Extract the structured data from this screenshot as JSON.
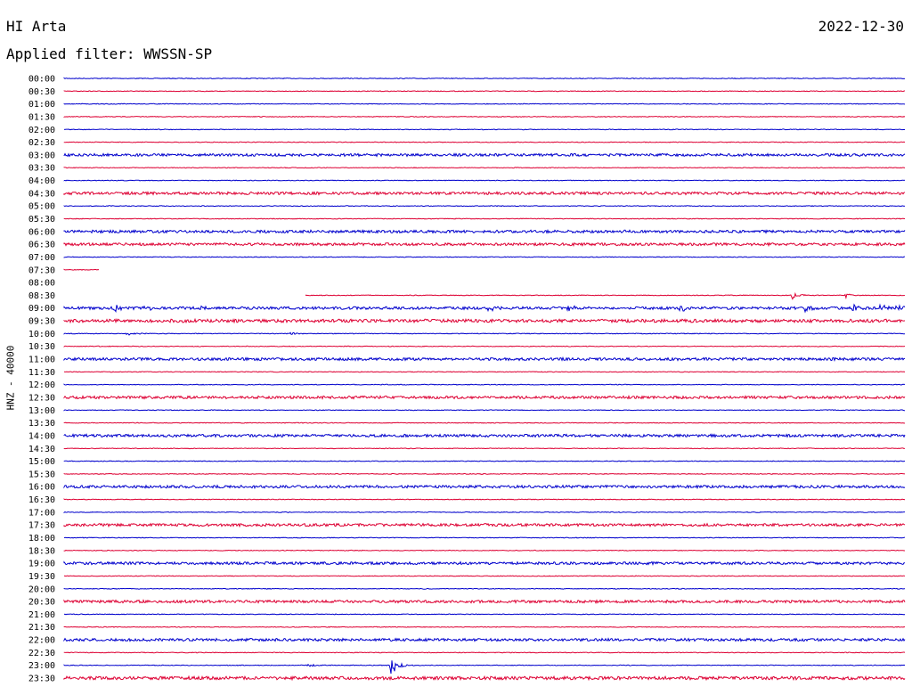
{
  "header": {
    "station": "HI Arta",
    "date": "2022-12-30",
    "filter": "Applied filter: WWSSN-SP"
  },
  "colors": {
    "even_row": "#0000cc",
    "odd_row": "#dd0033"
  },
  "chart_data": {
    "type": "line",
    "title": "HI Arta",
    "subtitle": "Applied filter: WWSSN-SP",
    "ylabel": "HNZ - 40000",
    "xlabel": "",
    "grid": false,
    "legend": "none",
    "rows": [
      {
        "label": "00:00"
      },
      {
        "label": "00:30"
      },
      {
        "label": "01:00",
        "events": [
          [
            0.045,
            1
          ]
        ]
      },
      {
        "label": "01:30"
      },
      {
        "label": "02:00"
      },
      {
        "label": "02:30"
      },
      {
        "label": "03:00",
        "noise": 1.5
      },
      {
        "label": "03:30"
      },
      {
        "label": "04:00"
      },
      {
        "label": "04:30",
        "noise": 1.5
      },
      {
        "label": "05:00"
      },
      {
        "label": "05:30"
      },
      {
        "label": "06:00",
        "noise": 1.5
      },
      {
        "label": "06:30",
        "noise": 1.5
      },
      {
        "label": "07:00"
      },
      {
        "label": "07:30",
        "start": 0.0,
        "end": 0.042
      },
      {
        "label": "08:00",
        "start": 1.0,
        "end": 1.0
      },
      {
        "label": "08:30",
        "start": 0.287,
        "events": [
          [
            0.865,
            6
          ],
          [
            0.93,
            3
          ]
        ]
      },
      {
        "label": "09:00",
        "noise": 1.5,
        "events": [
          [
            0.06,
            4
          ],
          [
            0.092,
            6
          ],
          [
            0.16,
            4
          ],
          [
            0.505,
            6
          ],
          [
            0.598,
            6
          ],
          [
            0.733,
            5
          ],
          [
            0.88,
            5
          ],
          [
            0.938,
            5
          ],
          [
            0.97,
            5
          ],
          [
            0.99,
            4
          ]
        ]
      },
      {
        "label": "09:30",
        "noise": 1.8
      },
      {
        "label": "10:00",
        "events": [
          [
            0.075,
            2
          ],
          [
            0.088,
            2
          ],
          [
            0.27,
            2
          ]
        ]
      },
      {
        "label": "10:30"
      },
      {
        "label": "11:00",
        "noise": 1.5
      },
      {
        "label": "11:30"
      },
      {
        "label": "12:00"
      },
      {
        "label": "12:30",
        "noise": 1.5
      },
      {
        "label": "13:00"
      },
      {
        "label": "13:30"
      },
      {
        "label": "14:00",
        "noise": 1.5
      },
      {
        "label": "14:30"
      },
      {
        "label": "15:00"
      },
      {
        "label": "15:30"
      },
      {
        "label": "16:00",
        "noise": 1.5
      },
      {
        "label": "16:30"
      },
      {
        "label": "17:00"
      },
      {
        "label": "17:30",
        "noise": 1.5
      },
      {
        "label": "18:00"
      },
      {
        "label": "18:30"
      },
      {
        "label": "19:00",
        "noise": 1.5
      },
      {
        "label": "19:30"
      },
      {
        "label": "20:00"
      },
      {
        "label": "20:30",
        "noise": 1.5
      },
      {
        "label": "21:00"
      },
      {
        "label": "21:30"
      },
      {
        "label": "22:00",
        "noise": 1.5
      },
      {
        "label": "22:30"
      },
      {
        "label": "23:00",
        "events": [
          [
            0.29,
            2
          ],
          [
            0.388,
            18
          ]
        ]
      },
      {
        "label": "23:30",
        "noise": 1.8
      }
    ]
  }
}
